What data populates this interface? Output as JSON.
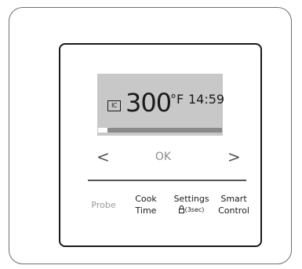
{
  "display": {
    "mode_icon": "IC",
    "temperature": "300",
    "unit": "°F",
    "clock": "14:59"
  },
  "nav": {
    "left_arrow": "<",
    "ok": "OK",
    "right_arrow": ">"
  },
  "buttons": {
    "probe": "Probe",
    "cook_line1": "Cook",
    "cook_line2": "Time",
    "settings_line1": "Settings",
    "settings_line2": "(3sec)",
    "smart_line1": "Smart",
    "smart_line2": "Control"
  },
  "colors": {
    "display_background": "#c8c8c8",
    "progress_bar": "#8a8a8a",
    "disabled_text": "#999999"
  }
}
